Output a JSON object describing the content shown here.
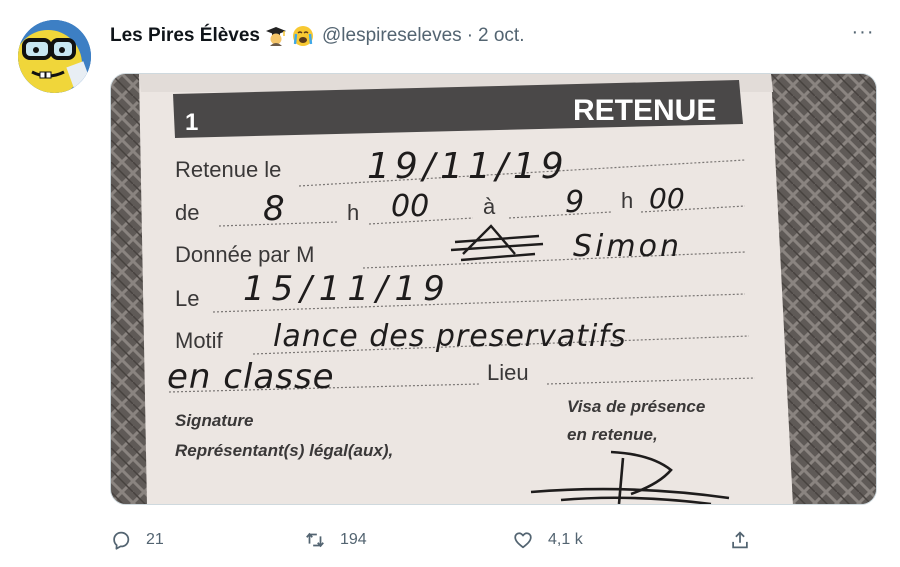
{
  "tweet": {
    "display_name": "Les Pires Élèves",
    "handle": "@lespireseleves",
    "separator": "·",
    "date": "2 oct.",
    "more_label": "···"
  },
  "card": {
    "number": "1",
    "heading": "RETENUE",
    "retenue_label": "Retenue le",
    "retenue_value": "19/11/19",
    "de_label": "de",
    "de_value": "8",
    "h_label": "h",
    "de_minutes": "00",
    "a_label": "à",
    "a_value": "9",
    "a_minutes": "00",
    "donnee_label": "Donnée par M",
    "donnee_value": "Simon",
    "le_label": "Le",
    "le_value": "15/11/19",
    "motif_label": "Motif",
    "motif_value_line1": "lance des preservatifs",
    "motif_value_line2": "en classe",
    "lieu_label": "Lieu",
    "signature_line1": "Signature",
    "signature_line2": "Représentant(s) légal(aux),",
    "visa_line1": "Visa de présence",
    "visa_line2": "en retenue,"
  },
  "actions": {
    "reply_count": "21",
    "retweet_count": "194",
    "like_count": "4,1 k"
  },
  "colors": {
    "text_secondary": "#536471",
    "paper": "#ece6e2",
    "banner": "#4a4848"
  }
}
